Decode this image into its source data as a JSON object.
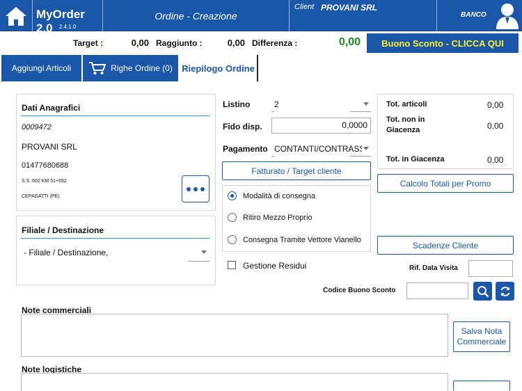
{
  "header": {
    "app_name": "MyOrder 2.0",
    "version": "2.4.1.0",
    "screen_title": "Ordine - Creazione",
    "client_label": "Client",
    "client_value": "PROVANI SRL",
    "user_label": "BANCO"
  },
  "totals": {
    "target_label": "Target :",
    "target_value": "0,00",
    "raggiunto_label": "Raggiunto :",
    "raggiunto_value": "0,00",
    "differenza_label": "Differenza :",
    "differenza_value": "0,00",
    "voucher_button": "Buono Sconto - CLICCA QUI"
  },
  "tabs": {
    "aggiungi": "Aggiungi  Articoli",
    "righe": "Righe Ordine (0)",
    "riepilogo": "Riepilogo Ordine"
  },
  "anagrafica": {
    "title": "Dati Anagrafici",
    "code": "0009472",
    "name": "PROVANI SRL",
    "phone": "01477680688",
    "address": "S.S. 602 KM 51+652",
    "city": "CEPAGATTI (PE)"
  },
  "filiale": {
    "title": "Filiale / Destinazione",
    "selected": "- Filiale / Destinazione,"
  },
  "form": {
    "listino_label": "Listino",
    "listino_value": "2",
    "fido_label": "Fido disp.",
    "fido_value": "0,0000",
    "pagamento_label": "Pagamento",
    "pagamento_value": "CONTANTI/CONTRASS",
    "fatturato_button": "Fatturato / Target cliente"
  },
  "consegna": {
    "options": [
      "Modalità di consegna",
      "Ritiro Mezzo Proprio",
      "Consegna Tramite Vettore Vianello"
    ],
    "selected_index": 0
  },
  "residui": {
    "label": "Gestione Residui",
    "checked": false
  },
  "summary": {
    "tot_articoli_label": "Tot. articoli",
    "tot_articoli_value": "0,00",
    "tot_non_giacenza_label_1": "Tot. non in",
    "tot_non_giacenza_label_2": "Giacenza",
    "tot_non_giacenza_value": "0,00",
    "tot_giacenza_label": "Tot. in Giacenza",
    "tot_giacenza_value": "0,00"
  },
  "buttons": {
    "calcolo": "Calcolo Totali per Promo",
    "scadenze": "Scadenze Cliente",
    "salva_nota_1": "Salva Nota",
    "salva_nota_2": "Commerciale"
  },
  "visita": {
    "rif_label": "Rif. Data Visita",
    "codice_label": "Codice Buono Sconto"
  },
  "notes": {
    "commerciali_label": "Note commerciali",
    "logistiche_label": "Note logistiche"
  },
  "colors": {
    "primary": "#1a57a8",
    "accent_yellow": "#ffef2a",
    "positive_green": "#1c8a1c",
    "field_line": "#2f8fd3"
  },
  "icons": [
    "home-icon",
    "user-avatar-icon",
    "cart-icon",
    "search-icon",
    "refresh-icon"
  ]
}
